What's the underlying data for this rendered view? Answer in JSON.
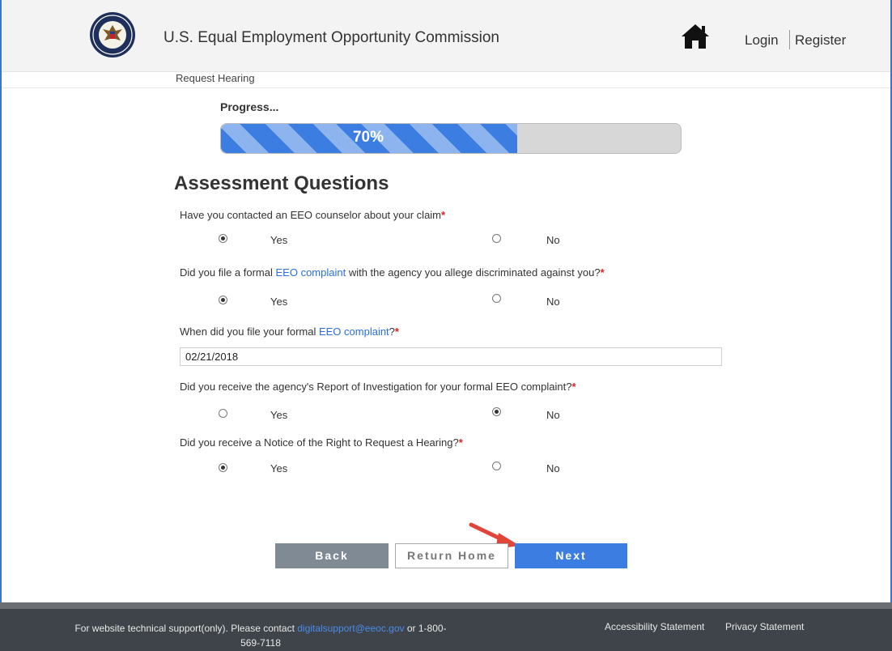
{
  "header": {
    "title": "U.S. Equal Employment Opportunity Commission",
    "login": "Login",
    "register": "Register"
  },
  "breadcrumb": "Request Hearing",
  "progress": {
    "label": "Progress...",
    "value_percent": 70,
    "text": "70%"
  },
  "section_title": "Assessment Questions",
  "questions": [
    {
      "pre": "Have you contacted an EEO counselor about your claim",
      "link": "",
      "post": "",
      "required": "*",
      "selected": "Yes"
    },
    {
      "pre": "Did you file a formal ",
      "link": "EEO complaint",
      "post": " with the agency you allege discriminated against you?",
      "required": "*",
      "selected": "Yes"
    },
    {
      "pre": "When did you file your formal ",
      "link": "EEO complaint",
      "post": "?",
      "required": "*",
      "value": "02/21/2018"
    },
    {
      "pre": "Did you receive the agency's Report of Investigation for your formal EEO complaint?",
      "link": "",
      "post": "",
      "required": "*",
      "selected": "No"
    },
    {
      "pre": "Did you receive a Notice of the Right to Request a Hearing?",
      "link": "",
      "post": "",
      "required": "*",
      "selected": "Yes"
    }
  ],
  "options": {
    "yes": "Yes",
    "no": "No"
  },
  "buttons": {
    "back": "Back",
    "return_home": "Return Home",
    "next": "Next"
  },
  "footer": {
    "support_pre": "For website technical support(only). Please contact ",
    "support_email": "digitalsupport@eeoc.gov",
    "support_post": " or 1-800-",
    "support_line2": "569-7118",
    "accessibility": "Accessibility Statement",
    "privacy": "Privacy Statement"
  },
  "colors": {
    "accent": "#3b7de0",
    "required": "#e02020",
    "link": "#2a6fdb",
    "footer": "#3e444a",
    "annotation_arrow": "#e0453a"
  },
  "icons": [
    "eeoc-seal-icon",
    "home-icon",
    "annotation-arrow"
  ]
}
